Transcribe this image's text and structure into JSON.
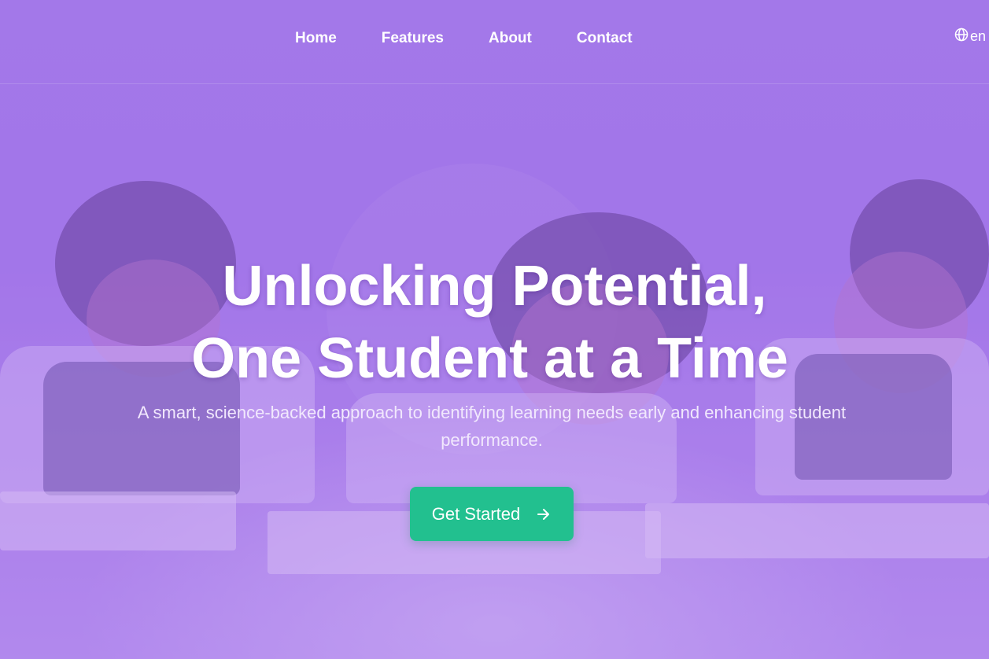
{
  "nav": {
    "links": [
      "Home",
      "Features",
      "About",
      "Contact"
    ],
    "language": "en"
  },
  "hero": {
    "title_line1": "Unlocking Potential,",
    "title_line2": "One Student at a Time",
    "subtitle": "A smart, science-backed approach to identifying learning needs early and enhancing student performance.",
    "cta_label": "Get Started",
    "cta_icon": "arrow-right-icon"
  },
  "colors": {
    "background": "#a87fea",
    "cta": "#22c08f",
    "text": "#ffffff"
  }
}
